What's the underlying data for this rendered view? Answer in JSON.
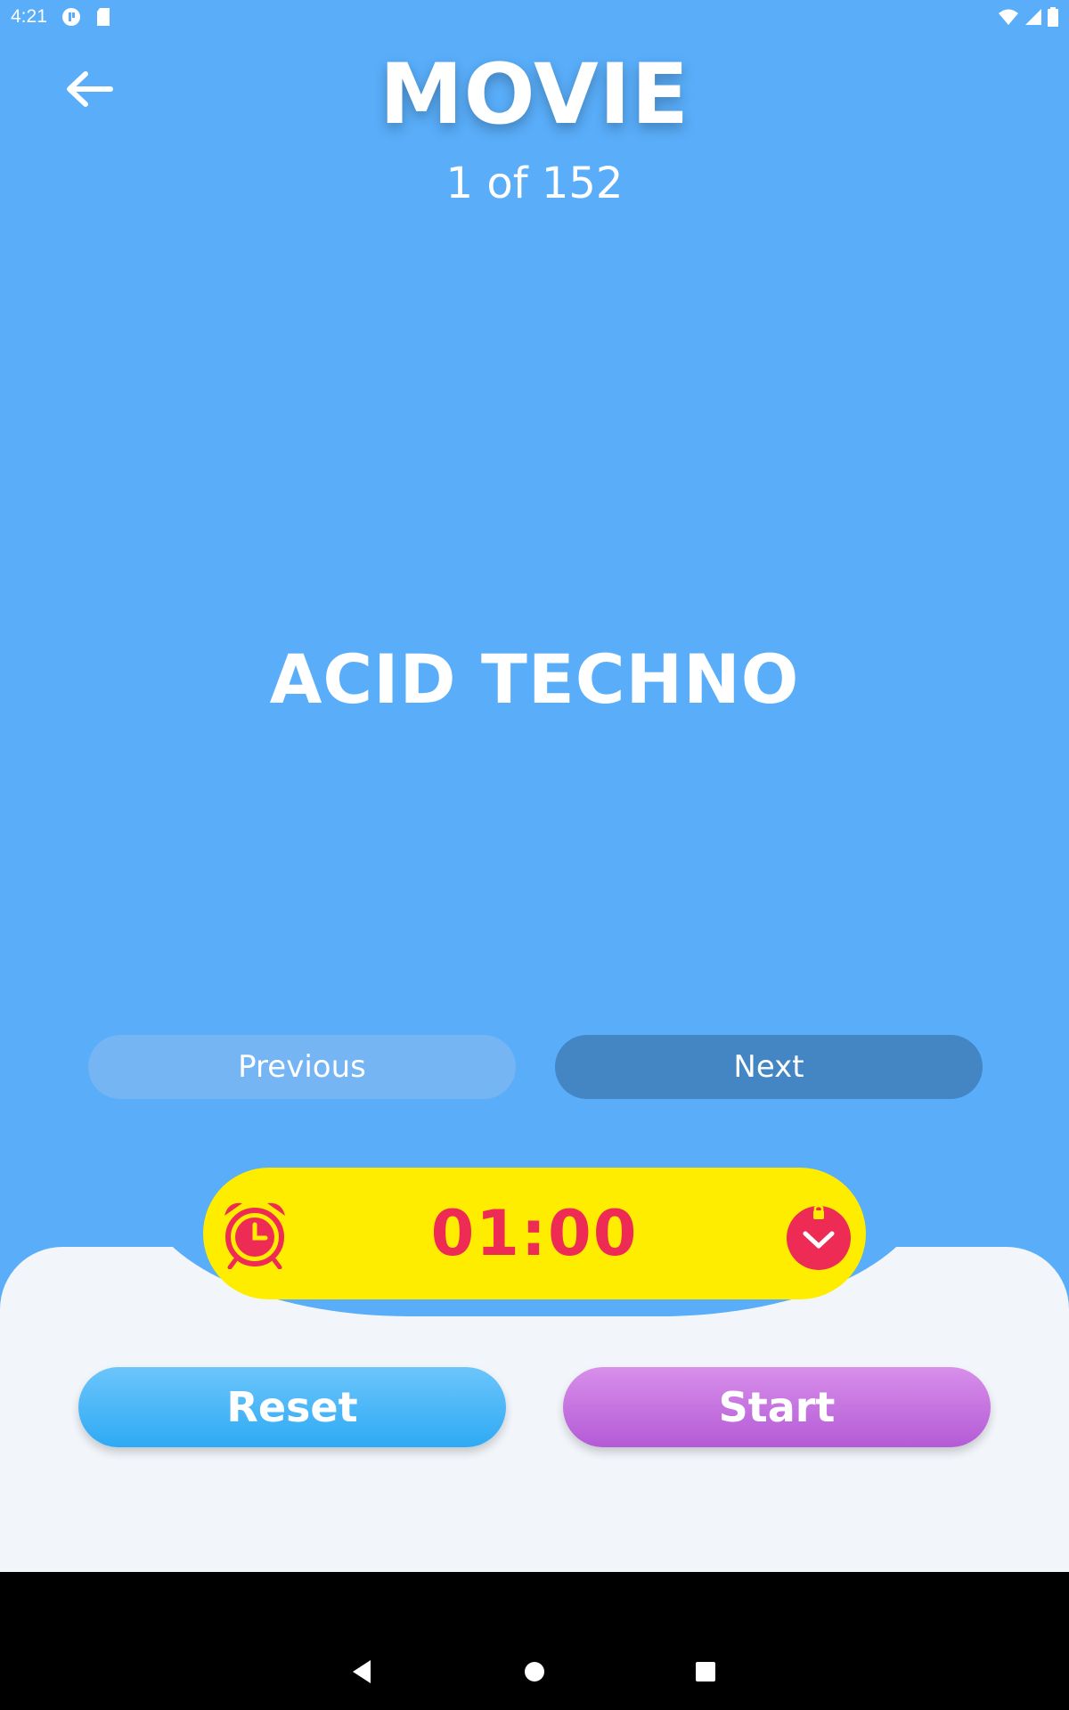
{
  "status_bar": {
    "time": "4:21"
  },
  "header": {
    "title": "MOVIE",
    "counter": "1 of 152"
  },
  "card": {
    "word": "ACID TECHNO"
  },
  "navigation": {
    "previous_label": "Previous",
    "next_label": "Next"
  },
  "timer": {
    "value": "01:00"
  },
  "actions": {
    "reset_label": "Reset",
    "start_label": "Start"
  },
  "colors": {
    "background": "#59adf9",
    "timer_bg": "#ffed00",
    "timer_text": "#ee2b55",
    "reset": "#2eaaf4",
    "start": "#b45ad6",
    "panel": "#f2f6fb"
  },
  "icons": [
    "back-arrow-icon",
    "alarm-clock-icon",
    "lock-icon",
    "wifi-icon",
    "signal-icon",
    "battery-icon",
    "nav-back-icon",
    "nav-home-icon",
    "nav-recents-icon"
  ]
}
